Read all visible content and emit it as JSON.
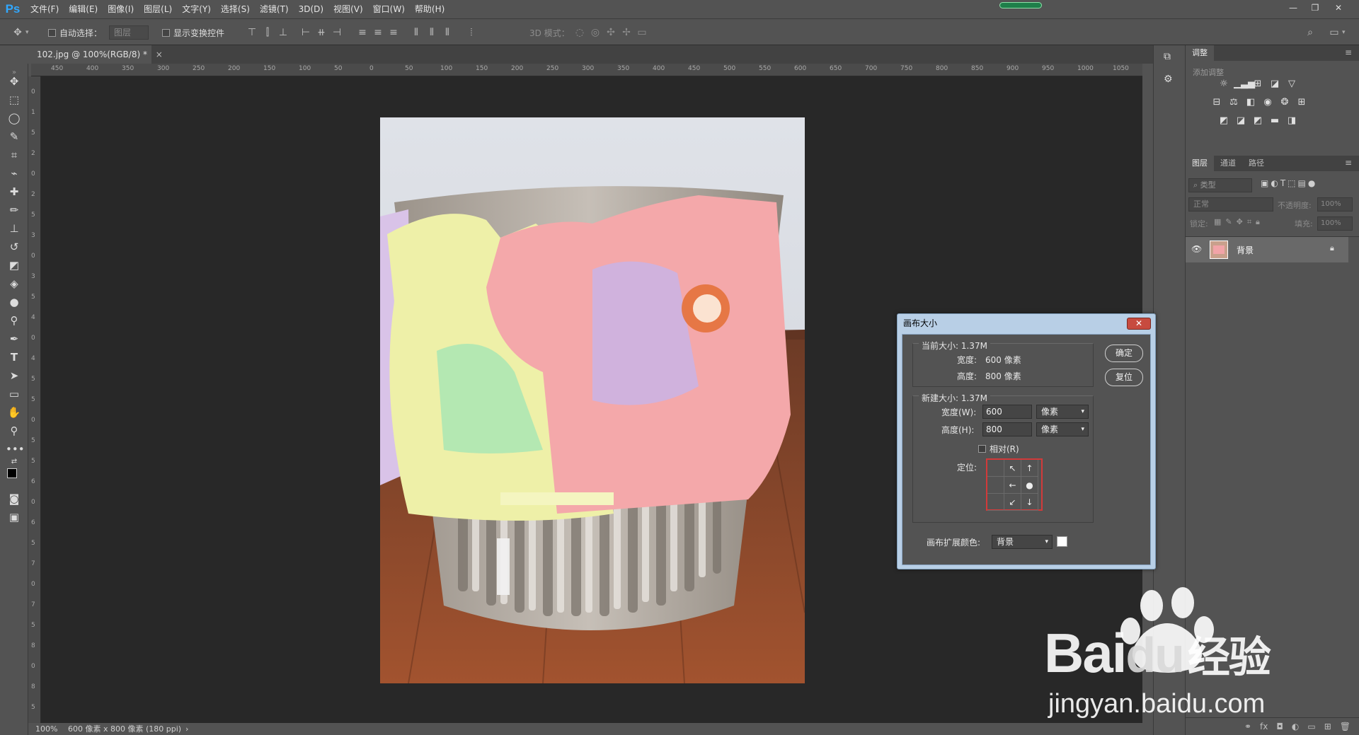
{
  "app": {
    "logo": "Ps"
  },
  "menu": [
    "文件(F)",
    "编辑(E)",
    "图像(I)",
    "图层(L)",
    "文字(Y)",
    "选择(S)",
    "滤镜(T)",
    "3D(D)",
    "视图(V)",
    "窗口(W)",
    "帮助(H)"
  ],
  "options": {
    "auto_select_label": "自动选择：",
    "auto_select_target": "图层",
    "show_transform_label": "显示变换控件",
    "mode_3d_label": "3D 模式："
  },
  "document": {
    "tab_title": "102.jpg @ 100%(RGB/8) *",
    "close": "×"
  },
  "ruler_top_labels": [
    "450",
    "400",
    "350",
    "300",
    "250",
    "200",
    "150",
    "100",
    "50",
    "0",
    "50",
    "100",
    "150",
    "200",
    "250",
    "300",
    "350",
    "400",
    "450",
    "500",
    "550",
    "600",
    "650",
    "700",
    "750",
    "800",
    "850",
    "900",
    "950",
    "1000",
    "1050"
  ],
  "ruler_left_labels": [
    "5",
    "0",
    "1",
    "5",
    "2",
    "0",
    "2",
    "5",
    "3",
    "0",
    "3",
    "5",
    "4",
    "0",
    "4",
    "5",
    "5",
    "0",
    "5",
    "5",
    "6",
    "0",
    "6",
    "5",
    "7",
    "0",
    "7",
    "5",
    "8",
    "0",
    "8",
    "5"
  ],
  "status": {
    "zoom": "100%",
    "info": "600 像素 x 800 像素 (180 ppi)",
    "arrow": "›"
  },
  "panels": {
    "adjust_tab": "调整",
    "add_adjust": "添加调整",
    "layers_tabs": [
      "图层",
      "通道",
      "路径"
    ],
    "filter_label": "类型",
    "blend_mode": "正常",
    "opacity_label": "不透明度:",
    "opacity_value": "100%",
    "lock_label": "锁定:",
    "fill_label": "填充:",
    "fill_value": "100%",
    "layer_name": "背景"
  },
  "dialog": {
    "title": "画布大小",
    "close": "✕",
    "current_size_label": "当前大小: 1.37M",
    "current_width_label": "宽度:",
    "current_width_value": "600 像素",
    "current_height_label": "高度:",
    "current_height_value": "800 像素",
    "new_size_label": "新建大小: 1.37M",
    "width_label": "宽度(W):",
    "width_value": "600",
    "width_unit": "像素",
    "height_label": "高度(H):",
    "height_value": "800",
    "height_unit": "像素",
    "relative_label": "相对(R)",
    "anchor_label": "定位:",
    "ext_color_label": "画布扩展颜色:",
    "ext_color_value": "背景",
    "ok_button": "确定",
    "reset_button": "复位"
  },
  "watermark": {
    "brand_a": "Bai",
    "brand_b": "du",
    "brand_c": "经验",
    "url": "jingyan.baidu.com"
  },
  "colors": {
    "accent_blue": "#31a8ff",
    "panel_bg": "#535353",
    "canvas_bg": "#282828",
    "dialog_frame": "#b8cfe6"
  }
}
